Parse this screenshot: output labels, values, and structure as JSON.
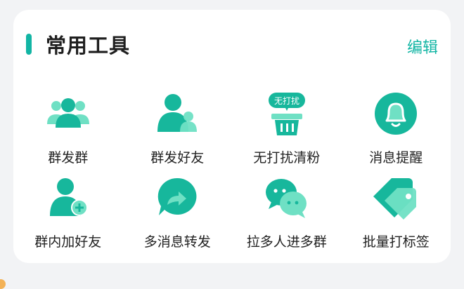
{
  "header": {
    "title": "常用工具",
    "edit_label": "编辑"
  },
  "tools": [
    {
      "label": "群发群",
      "icon": "group-broadcast-icon"
    },
    {
      "label": "群发好友",
      "icon": "friend-broadcast-icon"
    },
    {
      "label": "无打扰清粉",
      "icon": "no-disturb-clean-icon",
      "badge": "无打扰"
    },
    {
      "label": "消息提醒",
      "icon": "bell-icon"
    },
    {
      "label": "群内加好友",
      "icon": "add-friend-icon"
    },
    {
      "label": "多消息转发",
      "icon": "forward-icon"
    },
    {
      "label": "拉多人进多群",
      "icon": "chat-bubbles-icon"
    },
    {
      "label": "批量打标签",
      "icon": "tag-icon"
    }
  ],
  "colors": {
    "accent": "#12b5a4",
    "icon_dark": "#17b79c",
    "icon_light": "#6fe0c4"
  }
}
